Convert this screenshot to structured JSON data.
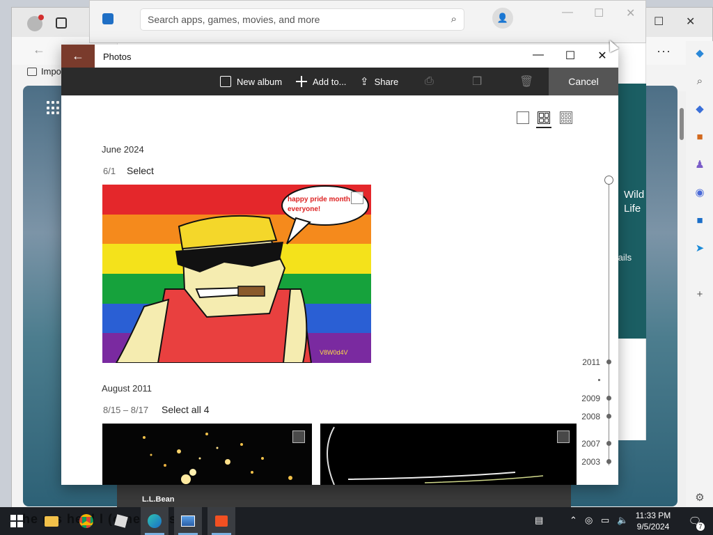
{
  "store": {
    "search_placeholder": "Search apps, games, movies, and more",
    "card_text_line1": "Wild",
    "card_text_line2": "Life",
    "details_label": "tails",
    "bottom_label": "L.L.Bean"
  },
  "edge": {
    "favorites_label": "Impo",
    "more_label": "···"
  },
  "photos": {
    "title": "Photos",
    "back_icon": "arrow-left-icon",
    "toolbar": {
      "new_album": "New album",
      "add_to": "Add to...",
      "share": "Share",
      "cancel": "Cancel"
    },
    "groups": [
      {
        "month": "June 2024",
        "range": "6/1",
        "select_label": "Select",
        "photo_text": "happy pride month everyone!",
        "signature": "V8W0d4V"
      },
      {
        "month": "August 2011",
        "range": "8/15 – 8/17",
        "select_label": "Select all 4"
      }
    ],
    "timeline": [
      "2011",
      "2009",
      "2008",
      "2007",
      "2003"
    ]
  },
  "taskbar": {
    "overlay_text": "he n s he d l (ometimes)",
    "time": "11:33 PM",
    "date": "9/5/2024",
    "notification_count": "7"
  },
  "colors": {
    "titlebar_accent": "#7a3b2c",
    "command_bar": "#2b2b2b",
    "cancel_button": "#555555"
  }
}
